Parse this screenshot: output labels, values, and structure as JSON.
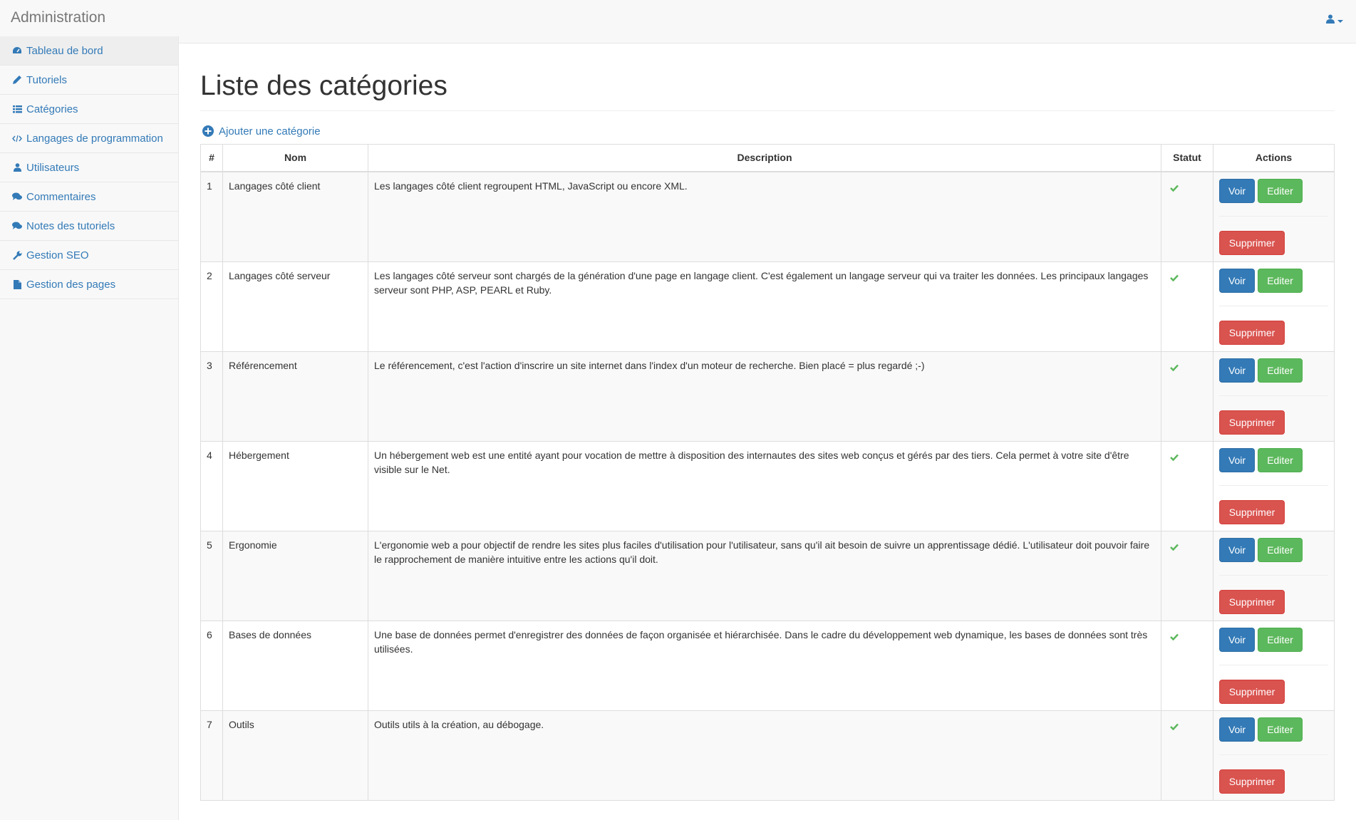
{
  "header": {
    "brand": "Administration",
    "user_icon": "user-icon"
  },
  "sidebar": {
    "items": [
      {
        "label": "Tableau de bord",
        "icon": "dashboard-icon",
        "active": true
      },
      {
        "label": "Tutoriels",
        "icon": "pencil-icon"
      },
      {
        "label": "Catégories",
        "icon": "list-icon"
      },
      {
        "label": "Langages de programmation",
        "icon": "code-icon"
      },
      {
        "label": "Utilisateurs",
        "icon": "user-icon"
      },
      {
        "label": "Commentaires",
        "icon": "comments-icon"
      },
      {
        "label": "Notes des tutoriels",
        "icon": "comments-icon"
      },
      {
        "label": "Gestion SEO",
        "icon": "wrench-icon"
      },
      {
        "label": "Gestion des pages",
        "icon": "file-icon"
      }
    ]
  },
  "main": {
    "title": "Liste des catégories",
    "add_label": "Ajouter une catégorie",
    "table": {
      "headers": [
        "#",
        "Nom",
        "Description",
        "Statut",
        "Actions"
      ],
      "rows": [
        {
          "id": "1",
          "name": "Langages côté client",
          "description": "Les langages côté client regroupent HTML, JavaScript ou encore XML."
        },
        {
          "id": "2",
          "name": "Langages côté serveur",
          "description": "Les langages côté serveur sont chargés de la génération d'une page en langage client. C'est également un langage serveur qui va traiter les données. Les principaux langages serveur sont PHP, ASP, PEARL et Ruby."
        },
        {
          "id": "3",
          "name": "Référencement",
          "description": "Le référencement, c'est l'action d'inscrire un site internet dans l'index d'un moteur de recherche. Bien placé = plus regardé ;-)"
        },
        {
          "id": "4",
          "name": "Hébergement",
          "description": "Un hébergement web est une entité ayant pour vocation de mettre à disposition des internautes des sites web conçus et gérés par des tiers. Cela permet à votre site d'être visible sur le Net."
        },
        {
          "id": "5",
          "name": "Ergonomie",
          "description": "L'ergonomie web a pour objectif de rendre les sites plus faciles d'utilisation pour l'utilisateur, sans qu'il ait besoin de suivre un apprentissage dédié. L'utilisateur doit pouvoir faire le rapprochement de manière intuitive entre les actions qu'il doit."
        },
        {
          "id": "6",
          "name": "Bases de données",
          "description": "Une base de données permet d'enregistrer des données de façon organisée et hiérarchisée. Dans le cadre du développement web dynamique, les bases de données sont très utilisées."
        },
        {
          "id": "7",
          "name": "Outils",
          "description": "Outils utils à la création, au débogage."
        }
      ],
      "status_icon": "check-icon",
      "buttons": {
        "view": "Voir",
        "edit": "Editer",
        "delete": "Supprimer"
      }
    }
  },
  "colors": {
    "link": "#337ab7",
    "primary": "#337ab7",
    "success": "#5cb85c",
    "danger": "#d9534f",
    "check": "#5cb85c"
  }
}
